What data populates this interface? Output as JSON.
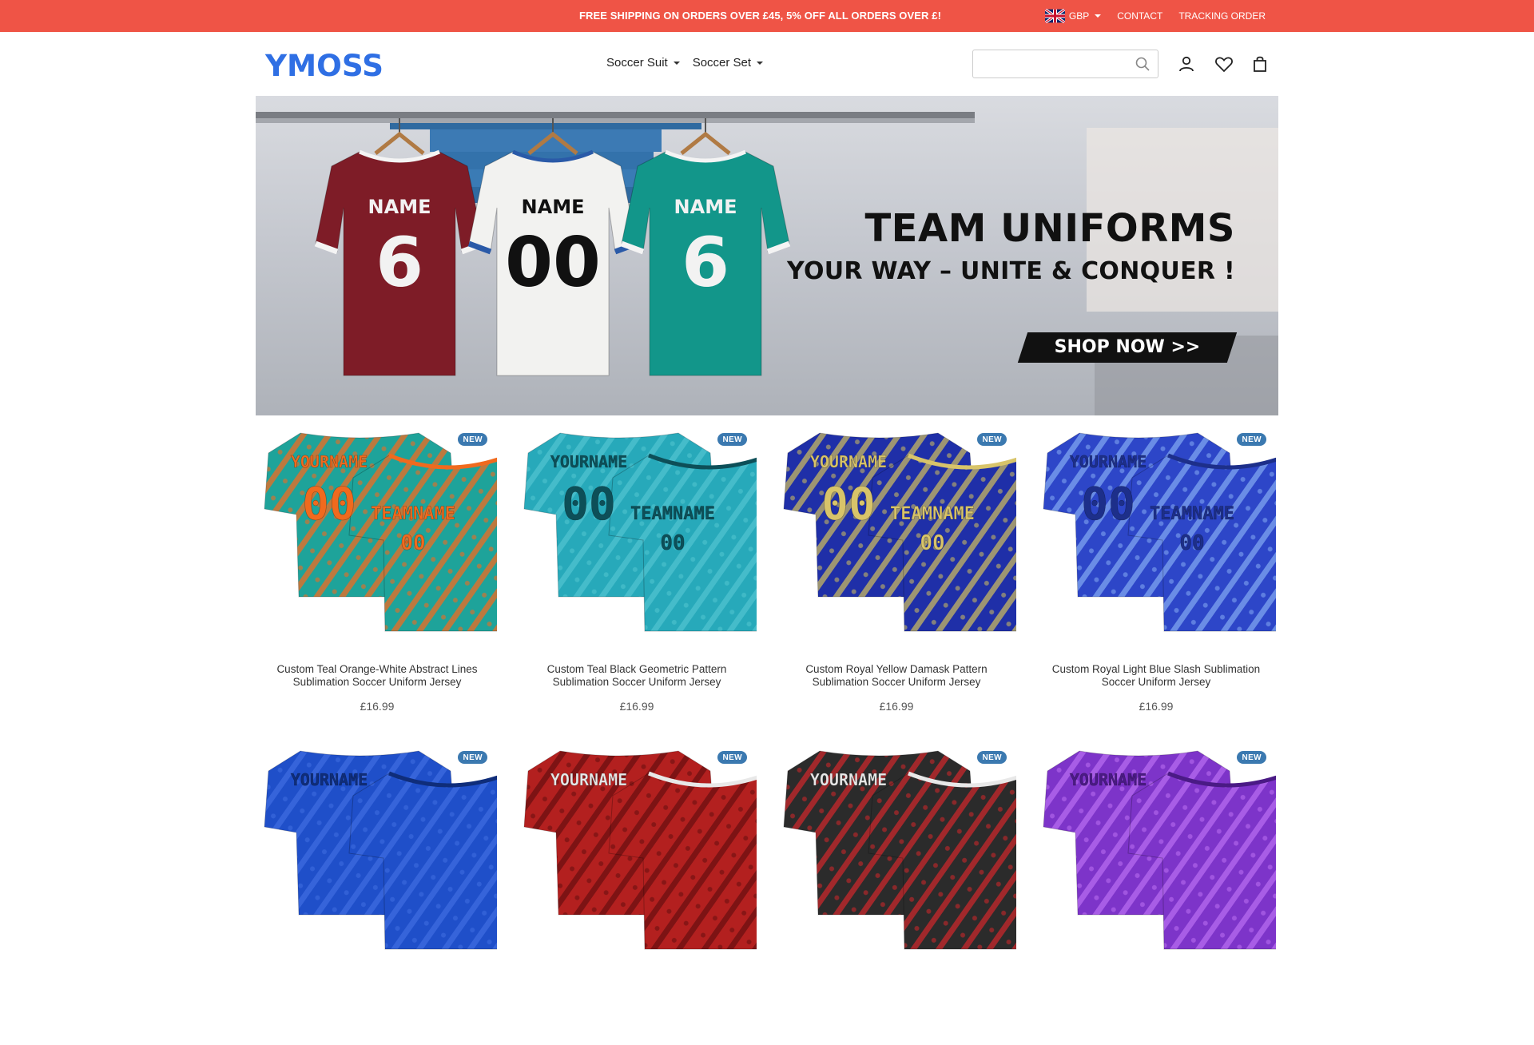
{
  "topbar": {
    "promo": "FREE SHIPPING ON ORDERS OVER £45, 5% OFF ALL ORDERS OVER £!",
    "currency": "GBP",
    "contact": "CONTACT",
    "tracking": "TRACKING ORDER"
  },
  "header": {
    "logo": "YMOSS",
    "nav": [
      {
        "label": "Soccer Suit"
      },
      {
        "label": "Soccer Set"
      }
    ],
    "search_placeholder": ""
  },
  "banner": {
    "headline": "TEAM UNIFORMS",
    "subheadline": "YOUR WAY – UNITE & CONQUER !",
    "cta": "SHOP NOW >>",
    "shirts": [
      {
        "name": "NAME",
        "number": "6",
        "color": "#7e1c27"
      },
      {
        "name": "NAME",
        "number": "00",
        "color": "#f2f2f0"
      },
      {
        "name": "NAME",
        "number": "6",
        "color": "#12968a"
      }
    ]
  },
  "colors": {
    "topbar": "#ef5446",
    "logo": "#2f6fe4",
    "badge": "#3b79b0"
  },
  "products": [
    {
      "badge": "NEW",
      "title": "Custom Teal Orange-White Abstract Lines Sublimation Soccer Uniform Jersey",
      "price": "£16.99",
      "base": "#1ea39a",
      "accent": "#f06a1e",
      "num": "#f06a1e",
      "front_name": "TEAMNAME",
      "back_name": "YOURNAME",
      "front_num": "00",
      "back_num": "00"
    },
    {
      "badge": "NEW",
      "title": "Custom Teal Black Geometric Pattern Sublimation Soccer Uniform Jersey",
      "price": "£16.99",
      "base": "#27a9ba",
      "accent": "#4fc3cf",
      "num": "#0d4f58",
      "front_name": "TEAMNAME",
      "back_name": "YOURNAME",
      "front_num": "00",
      "back_num": "00"
    },
    {
      "badge": "NEW",
      "title": "Custom Royal Yellow Damask Pattern Sublimation Soccer Uniform Jersey",
      "price": "£16.99",
      "base": "#1f2fa8",
      "accent": "#c7b660",
      "num": "#d8c46a",
      "front_name": "TEAMNAME",
      "back_name": "YOURNAME",
      "front_num": "00",
      "back_num": "00"
    },
    {
      "badge": "NEW",
      "title": "Custom Royal Light Blue Slash Sublimation Soccer Uniform Jersey",
      "price": "£16.99",
      "base": "#2d46c8",
      "accent": "#7fa4f0",
      "num": "#1d2f8a",
      "front_name": "TEAMNAME",
      "back_name": "YOURNAME",
      "front_num": "00",
      "back_num": "00"
    },
    {
      "badge": "NEW",
      "base": "#1f4fc9",
      "accent": "#3d6ae0",
      "num": "#0f2d7a",
      "back_name": "YOURNAME"
    },
    {
      "badge": "NEW",
      "base": "#b3201f",
      "accent": "#6b0f10",
      "num": "#e8e8e8",
      "back_name": "YOURNAME"
    },
    {
      "badge": "NEW",
      "base": "#2b2b2b",
      "accent": "#c8262a",
      "num": "#e8e8e8",
      "back_name": "YOURNAME"
    },
    {
      "badge": "NEW",
      "base": "#7d34c9",
      "accent": "#b76bf0",
      "num": "#4a1a85",
      "back_name": "YOURNAME"
    }
  ]
}
